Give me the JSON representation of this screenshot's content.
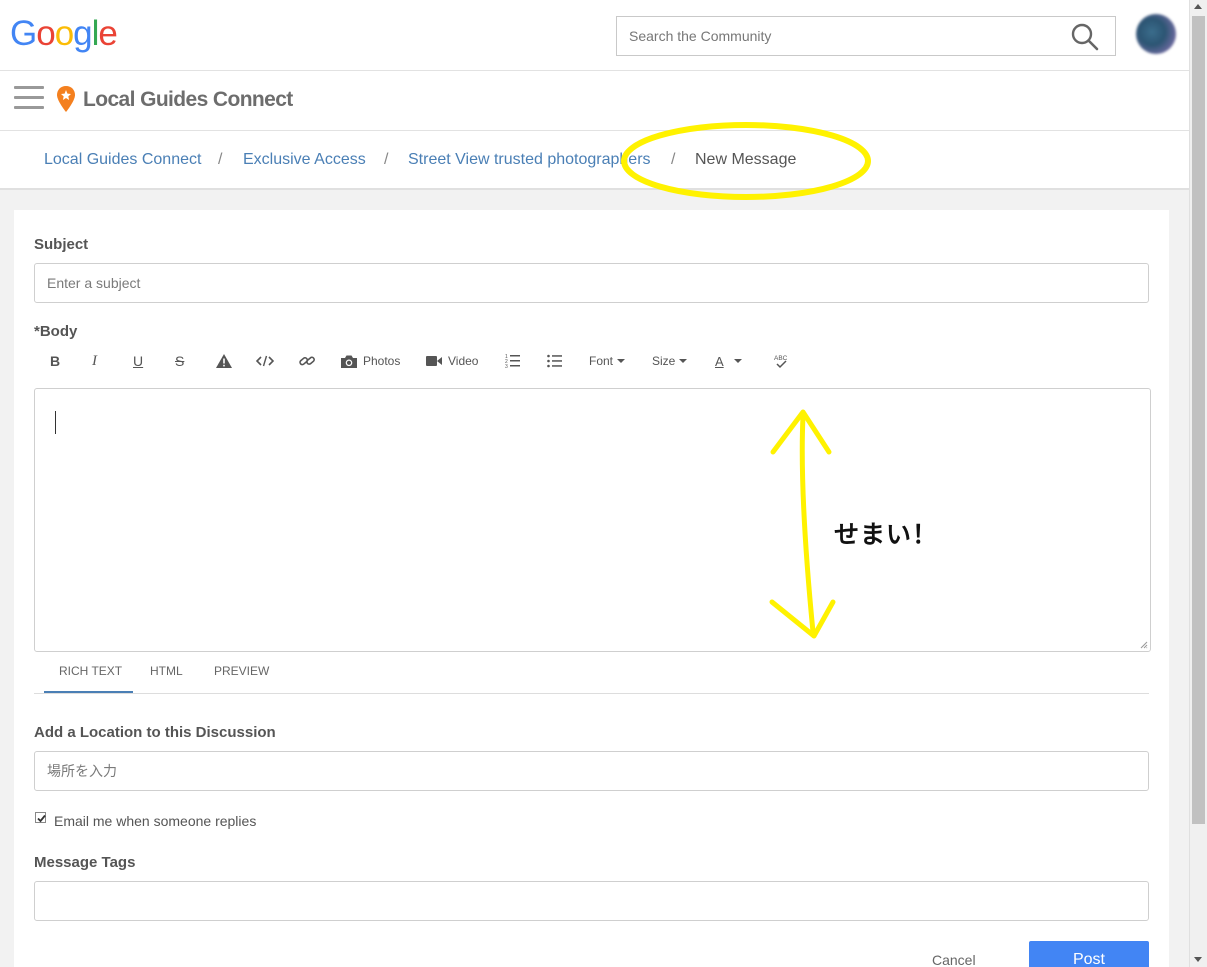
{
  "header": {
    "logo": {
      "letters": [
        {
          "char": "G",
          "color": "#4285F4"
        },
        {
          "char": "o",
          "color": "#EA4335"
        },
        {
          "char": "o",
          "color": "#FBBC05"
        },
        {
          "char": "g",
          "color": "#4285F4"
        },
        {
          "char": "l",
          "color": "#34A853"
        },
        {
          "char": "e",
          "color": "#EA4335"
        }
      ]
    },
    "search": {
      "placeholder": "Search the Community",
      "value": ""
    }
  },
  "community_bar": {
    "title": "Local Guides Connect",
    "pin_color": "#F4801F"
  },
  "breadcrumb": {
    "items": [
      "Local Guides Connect",
      "Exclusive Access",
      "Street View trusted photographers"
    ],
    "separator": "/",
    "current": "New Message"
  },
  "form": {
    "subject_label": "Subject",
    "subject_placeholder": "Enter a subject",
    "body_label": "*Body",
    "toolbar": {
      "photos_label": "Photos",
      "video_label": "Video",
      "font_label": "Font",
      "size_label": "Size",
      "color_label": "A",
      "bold": "B",
      "italic": "I",
      "underline": "U",
      "strike": "S"
    },
    "editor_tabs": [
      "RICH TEXT",
      "HTML",
      "PREVIEW"
    ],
    "active_tab": "RICH TEXT",
    "location_label": "Add a Location to this Discussion",
    "location_placeholder": "場所を入力",
    "email_checkbox_label": "Email me when someone replies",
    "email_checked": true,
    "tags_label": "Message Tags",
    "tags_value": "",
    "cancel_label": "Cancel",
    "post_label": "Post"
  },
  "annotation": {
    "text": "せまい！",
    "color": "#FFF200"
  },
  "colors": {
    "link": "#4A7FB5",
    "primary_button": "#4285F4"
  }
}
